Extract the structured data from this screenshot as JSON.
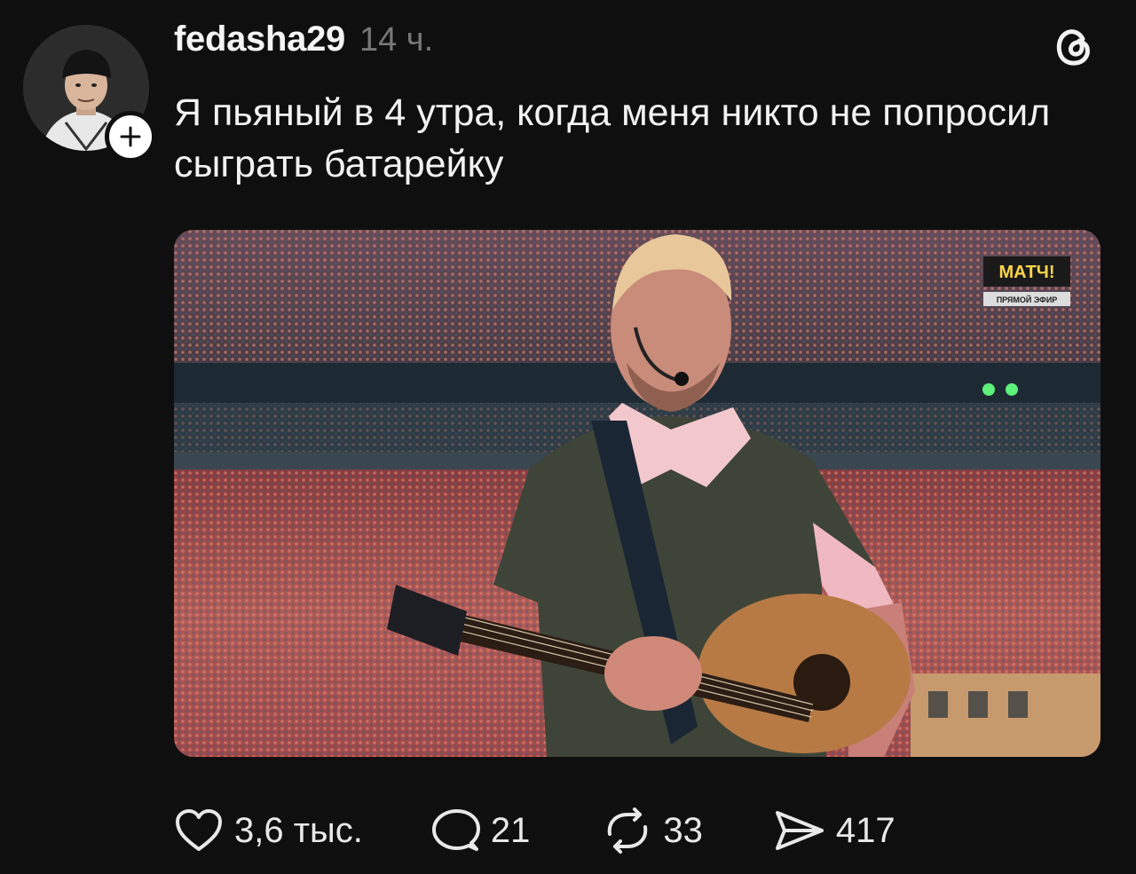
{
  "post": {
    "username": "fedasha29",
    "timestamp": "14 ч.",
    "text": "Я пьяный в 4 утра, когда меня никто не попросил сыграть батарейку"
  },
  "media": {
    "channel_logo": "МАТЧ!",
    "channel_caption": "ПРЯМОЙ ЭФИР"
  },
  "actions": {
    "likes": "3,6 тыс.",
    "comments": "21",
    "reposts": "33",
    "shares": "417"
  },
  "icons": {
    "like": "heart-icon",
    "comment": "comment-bubble-icon",
    "repost": "repost-icon",
    "share": "send-icon",
    "app": "threads-logo-icon",
    "follow": "plus-icon"
  },
  "colors": {
    "background": "#0f0f0f",
    "text": "#f2f2f2",
    "muted": "#777777"
  }
}
